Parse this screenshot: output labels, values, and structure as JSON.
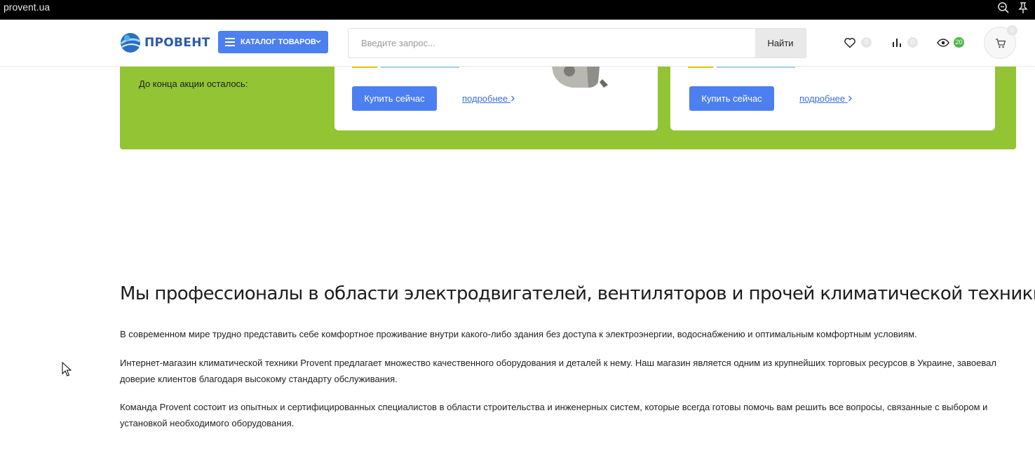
{
  "browser": {
    "url": "provent.ua"
  },
  "header": {
    "logo_text": "ПРОВЕНТ",
    "catalog_label": "КАТАЛОГ ТОВАРОВ",
    "search_placeholder": "Введите запрос...",
    "search_button": "Найти",
    "counters": {
      "wishlist": "0",
      "compare": "0",
      "viewed": "20",
      "cart": "0"
    }
  },
  "promo": {
    "countdown_label": "До конца акции осталось:",
    "cards": [
      {
        "buy_label": "Купить сейчас",
        "more_label": "подробнее"
      },
      {
        "buy_label": "Купить сейчас",
        "more_label": "подробнее"
      }
    ]
  },
  "about": {
    "title": "Мы профессионалы в области электродвигателей, вентиляторов и прочей климатической техники",
    "paragraphs": [
      "В современном мире трудно представить себе комфортное проживание внутри какого-либо здания без доступа к электроэнергии, водоснабжению и оптимальным комфортным условиям.",
      "Интернет-магазин климатической техники Provent предлагает множество качественного оборудования и деталей к нему. Наш магазин является одним из крупнейших торговых ресурсов в Украине, завоевал доверие клиентов благодаря высокому стандарту обслуживания.",
      "Команда Provent состоит из опытных и сертифицированных специалистов в области строительства и инженерных систем, которые всегда готовы помочь вам решить все вопросы, связанные с выбором и установкой необходимого оборудования."
    ]
  },
  "colors": {
    "accent_blue": "#4c7ff0",
    "promo_green": "#93c434",
    "viewed_badge": "#4cb84c"
  }
}
